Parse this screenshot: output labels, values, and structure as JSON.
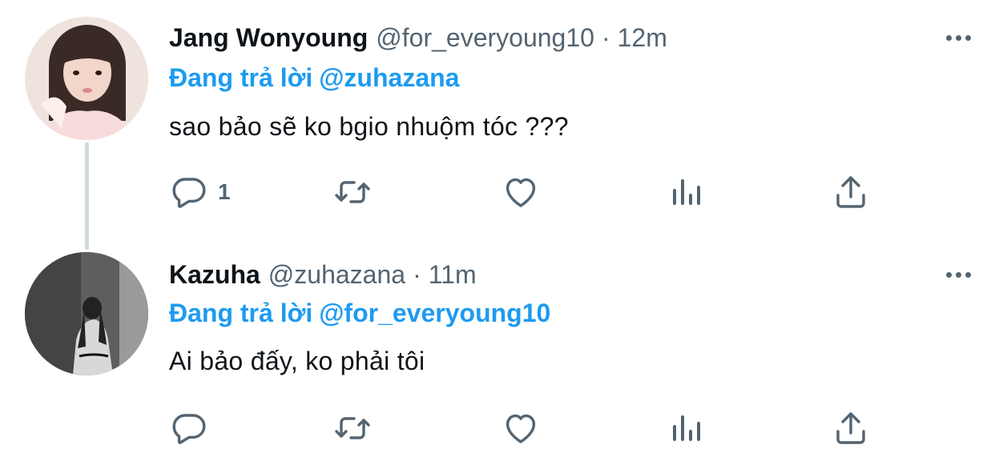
{
  "tweets": [
    {
      "name": "Jang Wonyoung",
      "handle": "@for_everyoung10",
      "separator": "·",
      "time": "12m",
      "reply_prefix": "Đang trả lời",
      "reply_to": "@zuhazana",
      "text": "sao bảo sẽ ko bgio nhuộm tóc ???",
      "reply_count": "1"
    },
    {
      "name": "Kazuha",
      "handle": "@zuhazana",
      "separator": "·",
      "time": "11m",
      "reply_prefix": "Đang trả lời",
      "reply_to": "@for_everyoung10",
      "text": "Ai bảo đấy, ko phải tôi",
      "reply_count": ""
    }
  ],
  "icons": {
    "reply": "reply-bubble-icon",
    "retweet": "retweet-icon",
    "like": "heart-icon",
    "views": "views-bar-chart-icon",
    "share": "share-upload-icon",
    "more": "more-dots-icon"
  },
  "colors": {
    "accent": "#1d9bf0",
    "muted": "#536471",
    "text": "#0f1419",
    "thread_line": "#cfd9de"
  }
}
